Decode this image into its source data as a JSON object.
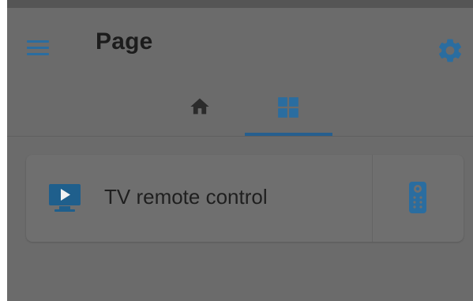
{
  "appbar": {
    "title": "Page",
    "menu_icon": "hamburger-menu-icon",
    "settings_icon": "gear-icon"
  },
  "tabs": [
    {
      "icon": "home-icon",
      "selected": false
    },
    {
      "icon": "dashboard-grid-icon",
      "selected": true
    }
  ],
  "card": {
    "icon": "tv-play-icon",
    "label": "TV remote control",
    "action_icon": "remote-control-icon"
  },
  "colors": {
    "accent": "#2a6da0",
    "tab_indicator": "#265f8e",
    "background": "#6b6b6b",
    "card": "#6f6f6f",
    "icon_dark": "#1f1f1f"
  }
}
